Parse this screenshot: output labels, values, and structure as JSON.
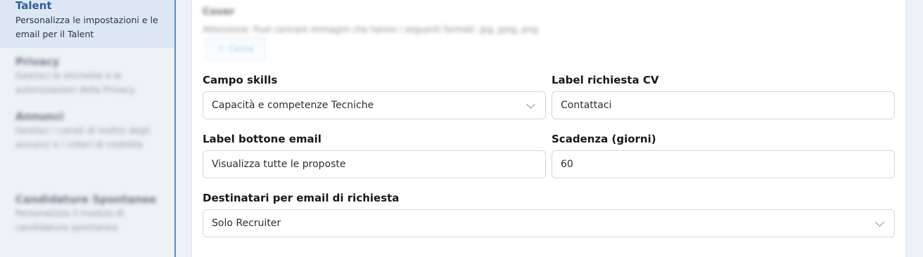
{
  "sidebar": {
    "items": [
      {
        "title": "Talent",
        "description": "Personalizza le impostazioni e le email per il Talent",
        "active": true
      },
      {
        "title": "Privacy",
        "description": "Gestisci le etichette e le autorizzazioni della Privacy"
      },
      {
        "title": "Annunci",
        "description": "Gestisci i canali di inoltro degli annunci e i criteri di visibilità"
      },
      {
        "title": "Candidature Spontanee",
        "description": "Personalizza il modulo di candidatura spontanea"
      }
    ]
  },
  "cover": {
    "title": "Cover",
    "note": "Attenzione: Puoi caricare immagini che hanno i seguenti formati: jpg, jpeg, png",
    "upload_label": "Carica"
  },
  "form": {
    "campo_skills": {
      "label": "Campo skills",
      "value": "Capacità e competenze Tecniche"
    },
    "label_cv": {
      "label": "Label richiesta CV",
      "value": "Contattaci"
    },
    "label_bottone": {
      "label": "Label bottone email",
      "value": "Visualizza tutte le proposte"
    },
    "scadenza": {
      "label": "Scadenza (giorni)",
      "value": "60"
    },
    "destinatari": {
      "label": "Destinatari per email di richiesta",
      "value": "Solo Recruiter"
    }
  },
  "colors": {
    "accent": "#2d5f95",
    "sidebar_rule": "#5a8fc7",
    "active_bg": "#dde7f3"
  }
}
